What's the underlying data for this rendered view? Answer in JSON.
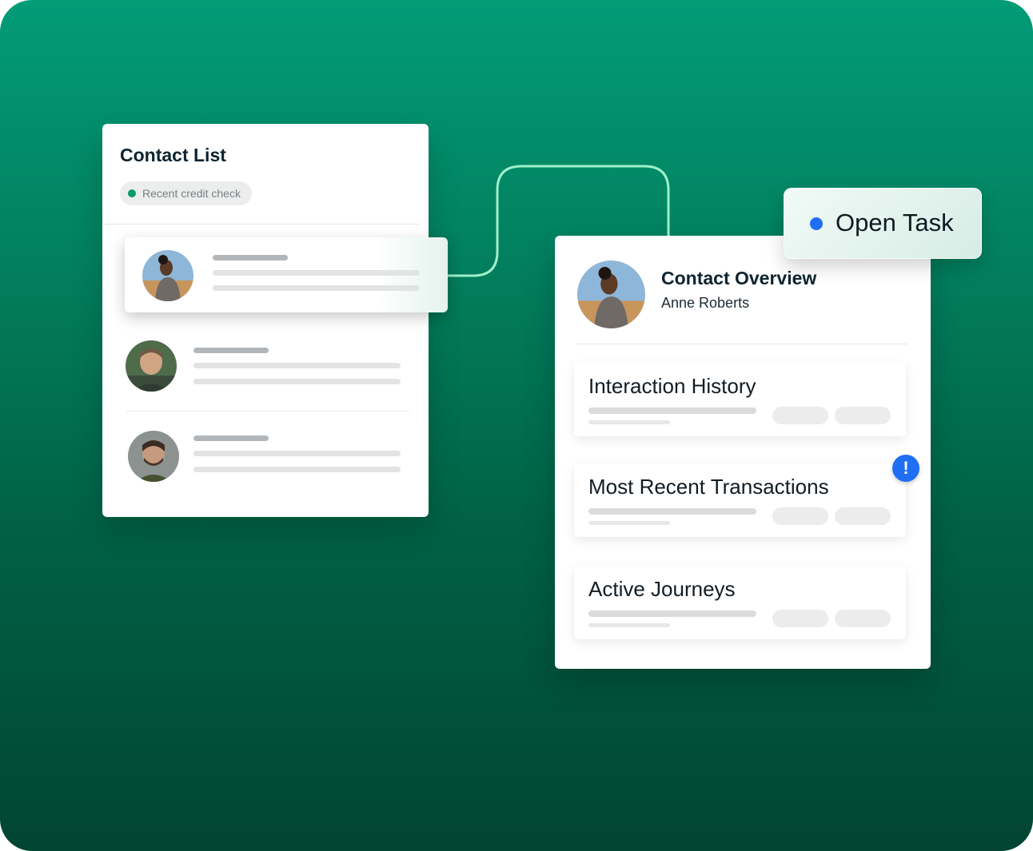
{
  "contact_list": {
    "title": "Contact List",
    "filter_chip": "Recent credit check"
  },
  "contact_overview": {
    "title": "Contact Overview",
    "name": "Anne Roberts",
    "sections": [
      {
        "title": "Interaction History"
      },
      {
        "title": "Most Recent Transactions"
      },
      {
        "title": "Active Journeys"
      }
    ],
    "alert_glyph": "!"
  },
  "open_task": {
    "label": "Open Task"
  },
  "colors": {
    "accent_green": "#0a9a6c",
    "connector": "#9ff0c8",
    "task_blue": "#1f6ff5"
  }
}
